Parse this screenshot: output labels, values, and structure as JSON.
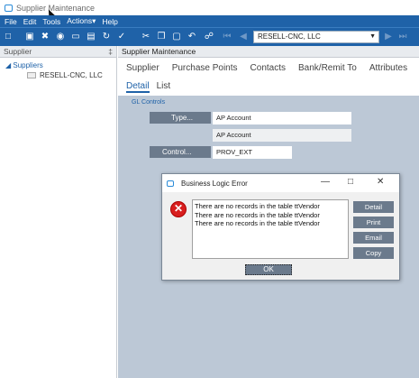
{
  "window": {
    "title": "Supplier Maintenance"
  },
  "menu": [
    "File",
    "Edit",
    "Tools",
    "Actions▾",
    "Help"
  ],
  "toolbar": {
    "supplier_value": "RESELL-CNC, LLC"
  },
  "left_panel": {
    "header": "Supplier",
    "pin": "‡",
    "tree_root": "Suppliers",
    "tree_child": "RESELL-CNC, LLC"
  },
  "main": {
    "header": "Supplier Maintenance",
    "tabs": [
      "Supplier",
      "Purchase Points",
      "Contacts",
      "Bank/Remit To",
      "Attributes",
      "S"
    ],
    "subtabs": [
      "Detail",
      "List"
    ],
    "section": "GL Controls",
    "type_button": "Type...",
    "type_value": "AP Account",
    "type_desc": "AP Account",
    "control_button": "Control...",
    "control_value": "PROV_EXT"
  },
  "dialog": {
    "title": "Business Logic Error",
    "messages": [
      "There are no records in the table ttVendor",
      "There are no records in the table ttVendor",
      "There are no records in the table ttVendor"
    ],
    "buttons": [
      "Detail",
      "Print",
      "Email",
      "Copy"
    ],
    "ok": "OK"
  }
}
